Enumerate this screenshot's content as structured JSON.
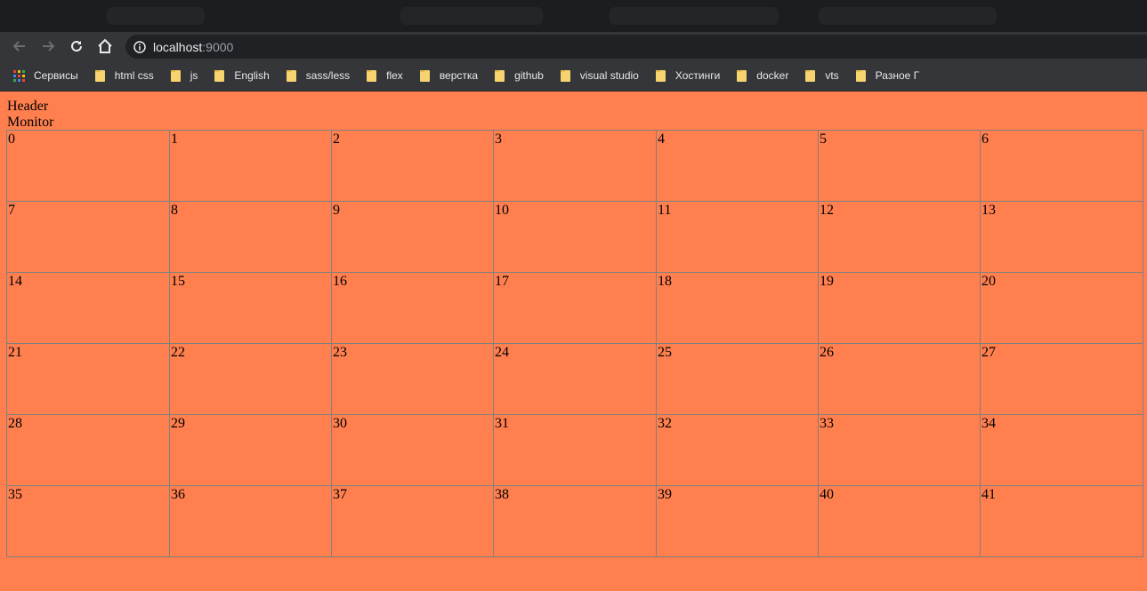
{
  "browser": {
    "url_host": "localhost",
    "url_port": ":9000",
    "bookmarks": [
      {
        "label": "Сервисы",
        "type": "apps"
      },
      {
        "label": "html css",
        "type": "folder"
      },
      {
        "label": "js",
        "type": "folder"
      },
      {
        "label": "English",
        "type": "folder"
      },
      {
        "label": "sass/less",
        "type": "folder"
      },
      {
        "label": "flex",
        "type": "folder"
      },
      {
        "label": "верстка",
        "type": "folder"
      },
      {
        "label": "github",
        "type": "folder"
      },
      {
        "label": "visual studio",
        "type": "folder"
      },
      {
        "label": "Хостинги",
        "type": "folder"
      },
      {
        "label": "docker",
        "type": "folder"
      },
      {
        "label": "vts",
        "type": "folder"
      },
      {
        "label": "Разное Г",
        "type": "folder"
      }
    ]
  },
  "page": {
    "header": "Header",
    "monitor": "Monitor",
    "background": "#ff7f4f",
    "cells": [
      "0",
      "1",
      "2",
      "3",
      "4",
      "5",
      "6",
      "7",
      "8",
      "9",
      "10",
      "11",
      "12",
      "13",
      "14",
      "15",
      "16",
      "17",
      "18",
      "19",
      "20",
      "21",
      "22",
      "23",
      "24",
      "25",
      "26",
      "27",
      "28",
      "29",
      "30",
      "31",
      "32",
      "33",
      "34",
      "35",
      "36",
      "37",
      "38",
      "39",
      "40",
      "41"
    ]
  }
}
